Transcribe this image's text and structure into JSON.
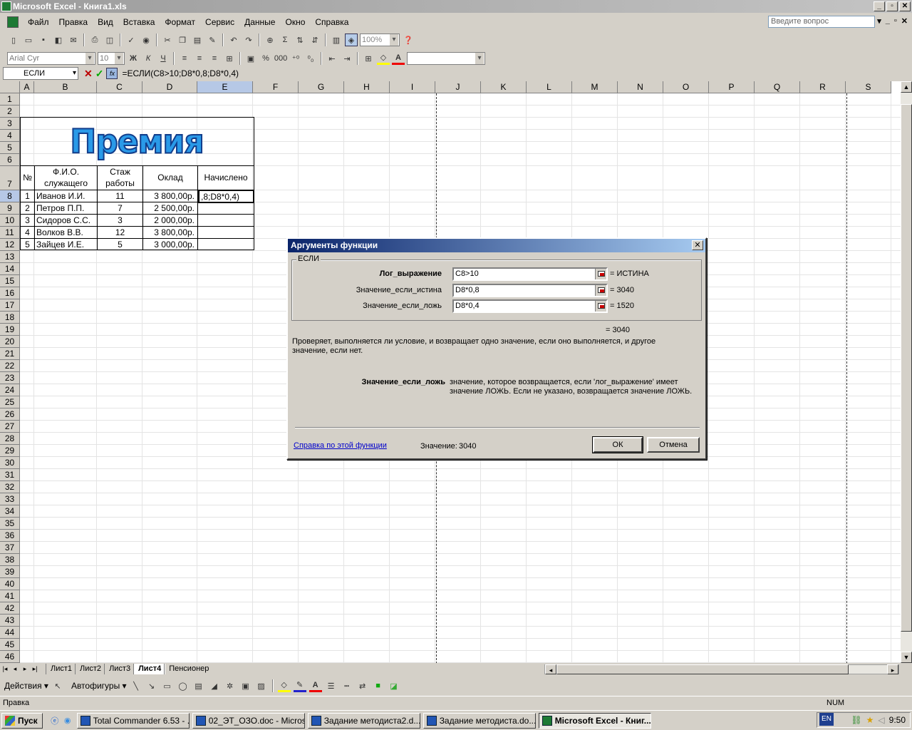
{
  "window": {
    "title": "Microsoft Excel - Книга1.xls",
    "controls": [
      "_",
      "▫",
      "✕"
    ]
  },
  "menu": {
    "items": [
      "Файл",
      "Правка",
      "Вид",
      "Вставка",
      "Формат",
      "Сервис",
      "Данные",
      "Окно",
      "Справка"
    ],
    "ask_placeholder": "Введите вопрос",
    "doc_controls": [
      "▾",
      "_",
      "▫",
      "✕"
    ]
  },
  "toolbar": {
    "zoom": "100%",
    "font": "Arial Cyr",
    "size": "10"
  },
  "formula_bar": {
    "name_box": "ЕСЛИ",
    "cancel": "✕",
    "enter": "✓",
    "fx": "fx",
    "formula": "=ЕСЛИ(C8>10;D8*0,8;D8*0,4)"
  },
  "columns": [
    "A",
    "B",
    "C",
    "D",
    "E",
    "F",
    "G",
    "H",
    "I",
    "J",
    "K",
    "L",
    "M",
    "N",
    "O",
    "P",
    "Q",
    "R",
    "S"
  ],
  "rows": [
    "1",
    "2",
    "3",
    "4",
    "5",
    "6",
    "7",
    "8",
    "9",
    "10",
    "11",
    "12",
    "13",
    "14",
    "15",
    "16",
    "17",
    "18",
    "19",
    "20",
    "21",
    "22",
    "23",
    "24",
    "25",
    "26",
    "27",
    "28",
    "29",
    "30",
    "31",
    "32",
    "33",
    "34",
    "35",
    "36",
    "37",
    "38",
    "39",
    "40",
    "41",
    "42",
    "43",
    "44",
    "45",
    "46"
  ],
  "wordart": "Премия",
  "table": {
    "headers": [
      "№",
      "Ф.И.О. служащего",
      "Стаж работы",
      "Оклад",
      "Начислено"
    ],
    "rows": [
      {
        "num": "1",
        "name": "Иванов И.И.",
        "exp": "11",
        "salary": "3 800,00р.",
        "accrued": ",8;D8*0,4)"
      },
      {
        "num": "2",
        "name": "Петров П.П.",
        "exp": "7",
        "salary": "2 500,00р.",
        "accrued": ""
      },
      {
        "num": "3",
        "name": "Сидоров С.С.",
        "exp": "3",
        "salary": "2 000,00р.",
        "accrued": ""
      },
      {
        "num": "4",
        "name": "Волков В.В.",
        "exp": "12",
        "salary": "3 800,00р.",
        "accrued": ""
      },
      {
        "num": "5",
        "name": "Зайцев И.Е.",
        "exp": "5",
        "salary": "3 000,00р.",
        "accrued": ""
      }
    ]
  },
  "sheet_tabs": {
    "nav": [
      "|◂",
      "◂",
      "▸",
      "▸|"
    ],
    "tabs": [
      "Лист1",
      "Лист2",
      "Лист3",
      "Лист4",
      "Пенсионер"
    ],
    "active": "Лист4"
  },
  "draw_toolbar": {
    "actions": "Действия ▾",
    "autoshapes": "Автофигуры ▾"
  },
  "status": {
    "mode": "Правка",
    "num": "NUM"
  },
  "dialog": {
    "title": "Аргументы функции",
    "close": "✕",
    "group": "ЕСЛИ",
    "args": [
      {
        "label": "Лог_выражение",
        "value": "C8>10",
        "result": "= ИСТИНА"
      },
      {
        "label": "Значение_если_истина",
        "value": "D8*0,8",
        "result": "= 3040"
      },
      {
        "label": "Значение_если_ложь",
        "value": "D8*0,4",
        "result": "= 1520"
      }
    ],
    "formula_result": "= 3040",
    "description": "Проверяет, выполняется ли условие, и возвращает одно значение, если оно выполняется, и другое значение, если нет.",
    "arg_help_name": "Значение_если_ложь",
    "arg_help_text": "значение, которое возвращается, если 'лог_выражение' имеет значение ЛОЖЬ. Если не указано, возвращается значение ЛОЖЬ.",
    "help_link": "Справка по этой функции",
    "value_label": "Значение:",
    "value": "3040",
    "ok": "ОК",
    "cancel": "Отмена"
  },
  "taskbar": {
    "start": "Пуск",
    "tasks": [
      "Total Commander 6.53 - ...",
      "02_ЭТ_ОЗО.doc - Micros...",
      "Задание методиста2.d...",
      "Задание методиста.do...",
      "Microsoft Excel - Книг..."
    ],
    "active_task": "Microsoft Excel - Книг...",
    "lang": "EN",
    "clock": "9:50"
  }
}
